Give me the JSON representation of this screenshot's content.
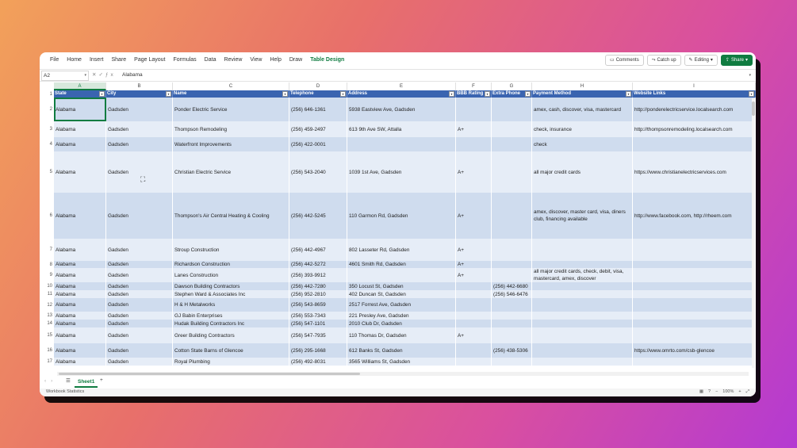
{
  "ribbon": {
    "menus": [
      "File",
      "Home",
      "Insert",
      "Share",
      "Page Layout",
      "Formulas",
      "Data",
      "Review",
      "View",
      "Help",
      "Draw",
      "Table Design"
    ],
    "active_menu": "Table Design",
    "comments": "Comments",
    "catchup": "Catch up",
    "editing": "Editing",
    "share": "Share"
  },
  "formula_bar": {
    "cell_ref": "A2",
    "value": "Alabama"
  },
  "columns": [
    "A",
    "B",
    "C",
    "D",
    "E",
    "F",
    "G",
    "H",
    "I"
  ],
  "headers": [
    "State",
    "City",
    "Name",
    "Telephone",
    "Address",
    "BBB Rating",
    "Extra Phone",
    "Payment Method",
    "Website Links"
  ],
  "rows": [
    {
      "n": "2",
      "cells": [
        "Alabama",
        "Gadsden",
        "Ponder Electric Service",
        "(256) 646-1361",
        "5938 Eastview Ave, Gadsden",
        "",
        "",
        "amex, cash, discover, visa, mastercard",
        "http://ponderelectricservice.localsearch.com"
      ]
    },
    {
      "n": "3",
      "cells": [
        "Alabama",
        "Gadsden",
        "Thompson Remodeling",
        "(256) 459-2497",
        "613 9th Ave SW, Attalla",
        "A+",
        "",
        "check, insurance",
        "http://thompsonremodeling.localsearch.com"
      ]
    },
    {
      "n": "4",
      "cells": [
        "Alabama",
        "Gadsden",
        "Waterfront Improvements",
        "(256) 422-0001",
        "",
        "",
        "",
        "check",
        ""
      ]
    },
    {
      "n": "5",
      "cells": [
        "Alabama",
        "Gadsden",
        "Christian Electric Service",
        "(256) 543-2040",
        "1039 1st Ave, Gadsden",
        "A+",
        "",
        "all major credit cards",
        "https://www.christianelectricservices.com"
      ]
    },
    {
      "n": "6",
      "cells": [
        "Alabama",
        "Gadsden",
        "Thompson's Air Central Heating & Cooling",
        "(256) 442-5245",
        "110 Garmon Rd, Gadsden",
        "A+",
        "",
        "amex, discover, master card, visa, diners club, financing available",
        "http://www.facebook.com, http://rheem.com"
      ]
    },
    {
      "n": "7",
      "cells": [
        "Alabama",
        "Gadsden",
        "Stroup Construction",
        "(256) 442-4967",
        "802 Lasseter Rd, Gadsden",
        "A+",
        "",
        "",
        ""
      ]
    },
    {
      "n": "8",
      "cells": [
        "Alabama",
        "Gadsden",
        "Richardson Construction",
        "(256) 442-5272",
        "4601 Smith Rd, Gadsden",
        "A+",
        "",
        "",
        ""
      ]
    },
    {
      "n": "9",
      "cells": [
        "Alabama",
        "Gadsden",
        "Lanes Construction",
        "(256) 393-9912",
        "",
        "A+",
        "",
        "all major credit cards, check, debit, visa, mastercard, amex, discover",
        ""
      ]
    },
    {
      "n": "10",
      "cells": [
        "Alabama",
        "Gadsden",
        "Dawson Building Contractors",
        "(256) 442-7280",
        "350 Locust St, Gadsden",
        "",
        "(256) 442-6680",
        "",
        ""
      ]
    },
    {
      "n": "11",
      "cells": [
        "Alabama",
        "Gadsden",
        "Stephen Ward & Associates Inc",
        "(256) 952-2810",
        "402 Duncan St, Gadsden",
        "",
        "(256) 546-6476",
        "",
        ""
      ]
    },
    {
      "n": "12",
      "cells": [
        "Alabama",
        "Gadsden",
        "H & H Metalworks",
        "(256) 543-8659",
        "2517 Forrest Ave, Gadsden",
        "",
        "",
        "",
        ""
      ]
    },
    {
      "n": "13",
      "cells": [
        "Alabama",
        "Gadsden",
        "GJ Babin Enterprises",
        "(256) 553-7343",
        "221 Presley Ave, Gadsden",
        "",
        "",
        "",
        ""
      ]
    },
    {
      "n": "14",
      "cells": [
        "Alabama",
        "Gadsden",
        "Hudak Building Contractors Inc",
        "(256) 547-1101",
        "2010 Club Dr, Gadsden",
        "",
        "",
        "",
        ""
      ]
    },
    {
      "n": "15",
      "cells": [
        "Alabama",
        "Gadsden",
        "Greer Building Contractors",
        "(256) 547-7935",
        "110 Thomas Dr, Gadsden",
        "A+",
        "",
        "",
        ""
      ]
    },
    {
      "n": "16",
      "cells": [
        "Alabama",
        "Gadsden",
        "Cotton State Barns of Glencoe",
        "(256) 295-1668",
        "612 Banks St, Gadsden",
        "",
        "(256) 438-5306",
        "",
        "https://www.omrto.com/csb-glencoe"
      ]
    },
    {
      "n": "17",
      "cells": [
        "Alabama",
        "Gadsden",
        "Royal Plumbing",
        "(256) 492-8031",
        "3565 Williams St, Gadsden",
        "",
        "",
        "",
        ""
      ]
    }
  ],
  "sheet": {
    "tab": "Sheet1",
    "add": "+"
  },
  "status": {
    "left": "Workbook Statistics",
    "zoom": "100%"
  },
  "colors": {
    "accent": "#107c41",
    "table_header": "#3a64b0",
    "band_dark": "#cfdcee",
    "band_light": "#e6edf7"
  }
}
